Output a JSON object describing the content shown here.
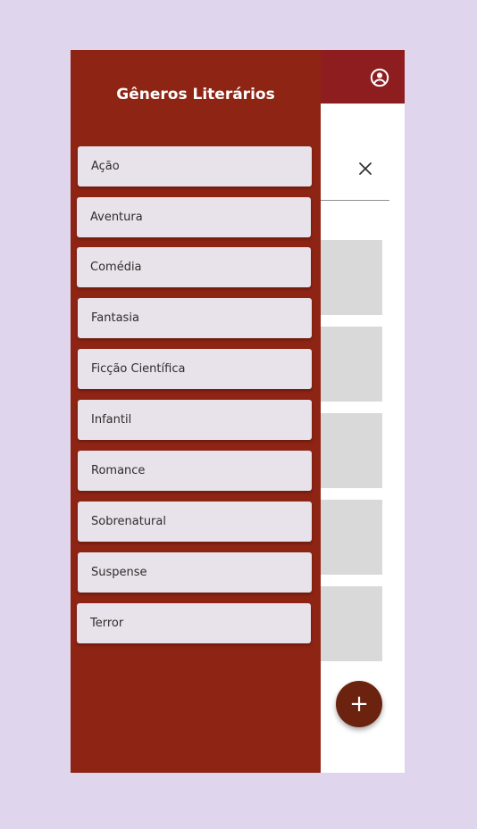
{
  "drawer": {
    "title": "Gêneros Literários",
    "genres": [
      {
        "label": "Ação"
      },
      {
        "label": "Aventura"
      },
      {
        "label": "Comédia"
      },
      {
        "label": "Fantasia"
      },
      {
        "label": "Ficção Científica"
      },
      {
        "label": "Infantil"
      },
      {
        "label": "Romance"
      },
      {
        "label": "Sobrenatural"
      },
      {
        "label": "Suspense"
      },
      {
        "label": "Terror"
      }
    ]
  },
  "appbar": {
    "profile_icon": "account-circle-icon"
  },
  "search": {
    "clear_icon": "close-icon"
  },
  "fab": {
    "label": "+"
  },
  "colors": {
    "background": "#dfd5ec",
    "appbar": "#8e1d1f",
    "drawer": "#8e2414",
    "item": "#e8e3eb",
    "card": "#d9d9d9",
    "fab": "#6b2310"
  }
}
